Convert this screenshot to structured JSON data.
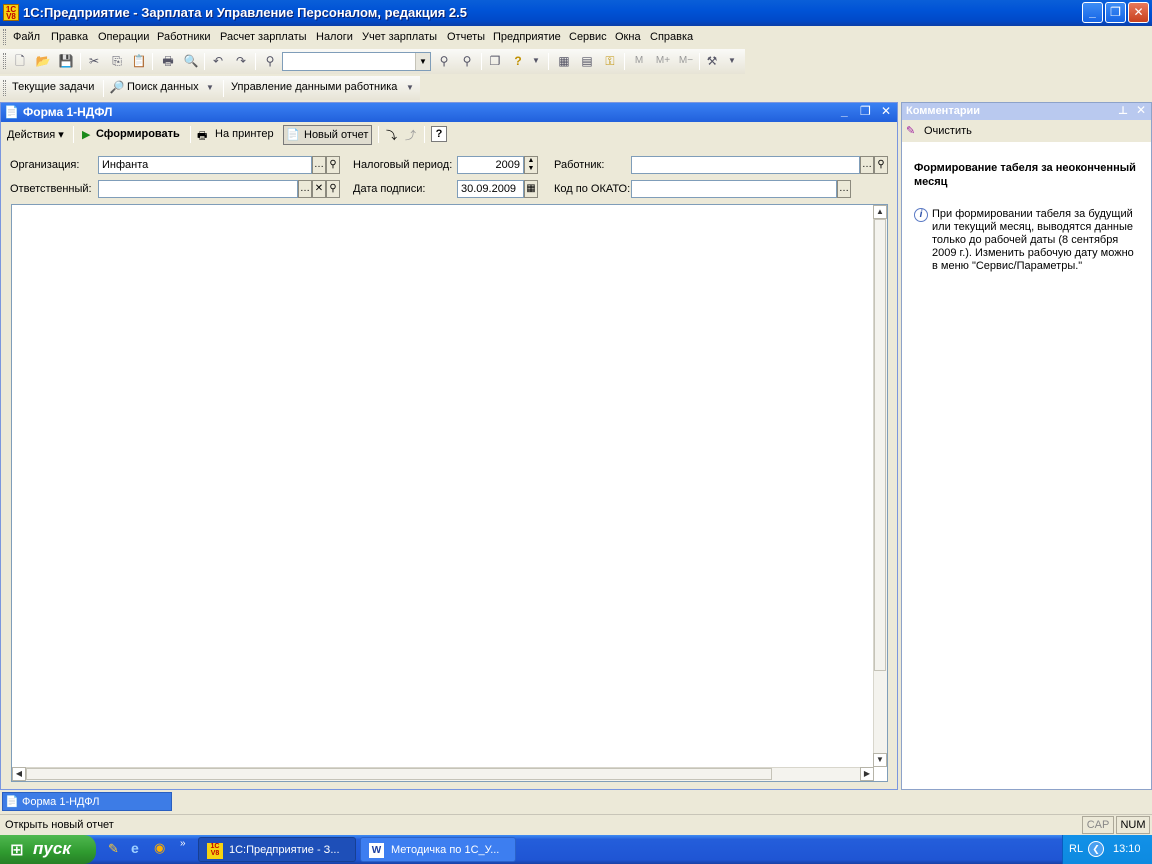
{
  "app": {
    "title": "1С:Предприятие - Зарплата и Управление Персоналом, редакция 2.5",
    "icon_text": "1С V8"
  },
  "menu": [
    "Файл",
    "Правка",
    "Операции",
    "Работники",
    "Расчет зарплаты",
    "Налоги",
    "Учет зарплаты",
    "Отчеты",
    "Предприятие",
    "Сервис",
    "Окна",
    "Справка"
  ],
  "toolbar2": {
    "tasks": "Текущие задачи",
    "search": "Поиск данных",
    "employee": "Управление данными работника"
  },
  "form": {
    "title": "Форма 1-НДФЛ",
    "actions_label": "Действия",
    "generate_label": "Сформировать",
    "printer_label": "На принтер",
    "new_report_label": "Новый отчет",
    "help_label": "?",
    "org_label": "Организация:",
    "org_value": "Инфанта",
    "responsible_label": "Ответственный:",
    "responsible_value": "",
    "tax_period_label": "Налоговый период:",
    "tax_period_value": "2009",
    "sign_date_label": "Дата подписи:",
    "sign_date_value": "30.09.2009",
    "employee_label": "Работник:",
    "employee_value": "",
    "okato_label": "Код по ОКАТО:",
    "okato_value": ""
  },
  "comments": {
    "title": "Комментарии",
    "clear_label": "Очистить",
    "heading": "Формирование табеля за неоконченный месяц",
    "body": "При формировании табеля за будущий или текущий месяц, выводятся данные только до рабочей даты (8 сентября 2009 г.). Изменить рабочую дату можно в меню \"Сервис/Параметры.\""
  },
  "window_tab": "Форма 1-НДФЛ",
  "status": {
    "text": "Открыть новый отчет",
    "cap": "CAP",
    "num": "NUM"
  },
  "taskbar": {
    "start": "пуск",
    "task1": "1С:Предприятие - З...",
    "task2": "Методичка по 1С_У...",
    "lang": "RL",
    "time": "13:10"
  }
}
